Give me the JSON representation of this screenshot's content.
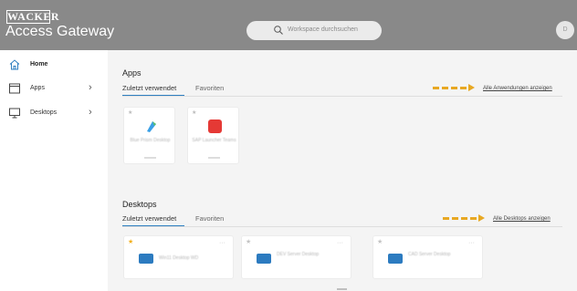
{
  "header": {
    "brand": "WACKER",
    "app_title": "Access Gateway",
    "search_placeholder": "Workspace durchsuchen",
    "avatar_initial": "D"
  },
  "sidebar": {
    "items": [
      {
        "label": "Home",
        "icon": "home-icon"
      },
      {
        "label": "Apps",
        "icon": "apps-window-icon",
        "chevron": "›"
      },
      {
        "label": "Desktops",
        "icon": "monitor-icon",
        "chevron": "›"
      }
    ]
  },
  "apps_section": {
    "title": "Apps",
    "tab_recent": "Zuletzt verwendet",
    "tab_favorites": "Favoriten",
    "view_all_link": "Alle Anwendungen anzeigen",
    "tiles": [
      {
        "name": "Blue Prism Desktop",
        "icon_color": "#3aa0e6",
        "icon_accent": "#5cc16a"
      },
      {
        "name": "SAP Launcher Teams",
        "icon_color": "#e53935"
      }
    ]
  },
  "desktops_section": {
    "title": "Desktops",
    "tab_recent": "Zuletzt verwendet",
    "tab_favorites": "Favoriten",
    "view_all_link": "Alle Desktops anzeigen",
    "tiles": [
      {
        "name": "Win11 Desktop WD",
        "favorite": true
      },
      {
        "name": "DEV Server Desktop",
        "favorite": false
      },
      {
        "name": "CAD Server Desktop",
        "favorite": false
      }
    ]
  },
  "colors": {
    "header_bg": "#898989",
    "accent_blue": "#2f7fc1",
    "arrow_annotation": "#e8a822",
    "favorite_star": "#f2b01e"
  }
}
